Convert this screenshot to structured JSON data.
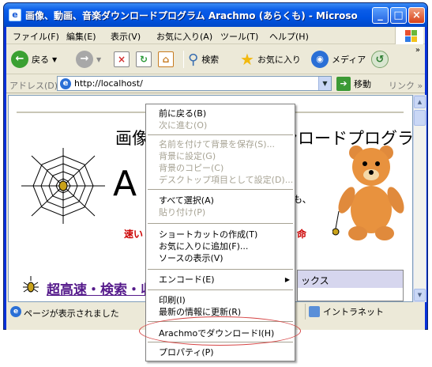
{
  "window": {
    "icon": "ie-page-icon",
    "title": "画像、動画、音楽ダウンロードプログラム Arachmo (あらくも) - Microsof...",
    "minimize": "_",
    "maximize": "□",
    "close": "×"
  },
  "menubar": {
    "items": [
      "ファイル(F)",
      "編集(E)",
      "表示(V)",
      "お気に入り(A)",
      "ツール(T)",
      "ヘルプ(H)"
    ]
  },
  "toolbar": {
    "back": "戻る",
    "search": "検索",
    "favorites": "お気に入り",
    "media": "メディア",
    "more": "»"
  },
  "address": {
    "label": "アドレス(D)",
    "url": "http://localhost/",
    "go": "移動",
    "links": "リンク",
    "more": "»"
  },
  "page": {
    "title": "画像・動画・音楽ダウンロードプログラム アラクモ 公式サイ",
    "big_letter": "A",
    "side_text": "も、",
    "red_left": "速い",
    "red_right": "命",
    "link_text": "超高速・検索・収",
    "box_text": "ックス"
  },
  "status": {
    "text": "ページが表示されました",
    "zone": "イントラネット"
  },
  "context_menu": {
    "items": [
      {
        "label": "前に戻る(B)",
        "disabled": false
      },
      {
        "label": "次に進む(O)",
        "disabled": true
      },
      {
        "label": "名前を付けて背景を保存(S)...",
        "disabled": true
      },
      {
        "label": "背景に設定(G)",
        "disabled": true
      },
      {
        "label": "背景のコピー(C)",
        "disabled": true
      },
      {
        "label": "デスクトップ項目として設定(D)...",
        "disabled": true
      },
      {
        "label": "すべて選択(A)",
        "disabled": false
      },
      {
        "label": "貼り付け(P)",
        "disabled": true
      },
      {
        "label": "ショートカットの作成(T)",
        "disabled": false
      },
      {
        "label": "お気に入りに追加(F)...",
        "disabled": false
      },
      {
        "label": "ソースの表示(V)",
        "disabled": false
      },
      {
        "label": "エンコード(E)",
        "disabled": false,
        "submenu": true
      },
      {
        "label": "印刷(I)",
        "disabled": false
      },
      {
        "label": "最新の情報に更新(R)",
        "disabled": false
      },
      {
        "label": "ArachmoでダウンロードI(H)",
        "disabled": false
      },
      {
        "label": "プロパティ(P)",
        "disabled": false
      }
    ],
    "submenu_arrow": "▶"
  }
}
